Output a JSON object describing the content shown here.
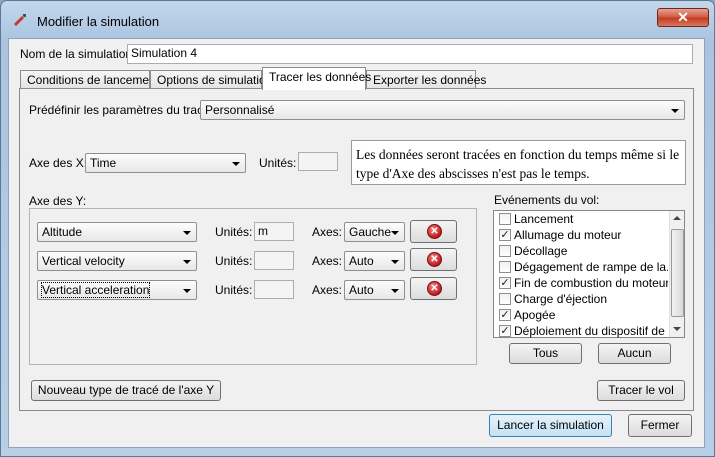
{
  "window": {
    "title": "Modifier la simulation",
    "close_glyph": "✕",
    "icon": "rocket-icon"
  },
  "name_field": {
    "label": "Nom de la simulation:",
    "value": "Simulation 4"
  },
  "tabs": [
    {
      "label": "Conditions de lancement"
    },
    {
      "label": "Options de simulation"
    },
    {
      "label": "Tracer les données"
    },
    {
      "label": "Exporter les données"
    }
  ],
  "preset": {
    "label": "Prédéfinir les paramètres du tracé:",
    "value": "Personnalisé"
  },
  "x_axis": {
    "label": "Axe des X:",
    "value": "Time",
    "units_label": "Unités:",
    "units_value": ""
  },
  "info_note": "Les données seront tracées en fonction du temps même si le type d'Axe des abscisses n'est pas le temps.",
  "y_axis": {
    "label": "Axe des Y:",
    "rows": [
      {
        "variable": "Altitude",
        "units_label": "Unités:",
        "units_value": "m",
        "axes_label": "Axes:",
        "axes_value": "Gauche"
      },
      {
        "variable": "Vertical velocity",
        "units_label": "Unités:",
        "units_value": "",
        "axes_label": "Axes:",
        "axes_value": "Auto"
      },
      {
        "variable": "Vertical acceleration",
        "units_label": "Unités:",
        "units_value": "",
        "axes_label": "Axes:",
        "axes_value": "Auto"
      }
    ]
  },
  "events": {
    "label": "Evénements du vol:",
    "items": [
      {
        "label": "Lancement",
        "checked": false
      },
      {
        "label": "Allumage du moteur",
        "checked": true
      },
      {
        "label": "Décollage",
        "checked": false
      },
      {
        "label": "Dégagement de rampe de la...",
        "checked": false
      },
      {
        "label": "Fin de combustion du moteur",
        "checked": true
      },
      {
        "label": "Charge d'éjection",
        "checked": false
      },
      {
        "label": "Apogée",
        "checked": true
      },
      {
        "label": "Déploiement du dispositif de ...",
        "checked": true
      }
    ],
    "all_button": "Tous",
    "none_button": "Aucun"
  },
  "buttons": {
    "new_y_axis": "Nouveau type de tracé de l'axe Y",
    "plot_flight": "Tracer le vol",
    "run_simulation": "Lancer la simulation",
    "close": "Fermer"
  },
  "check_glyph": "✓",
  "delete_glyph": "✕"
}
